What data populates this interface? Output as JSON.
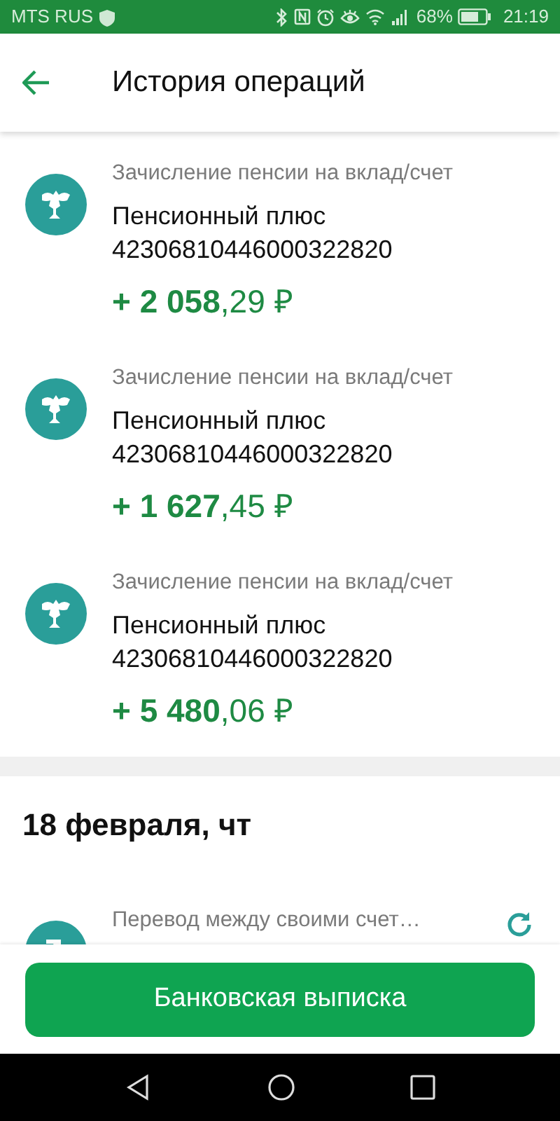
{
  "status_bar": {
    "carrier": "MTS RUS",
    "battery": "68%",
    "time": "21:19"
  },
  "header": {
    "title": "История операций"
  },
  "groups": [
    {
      "items": [
        {
          "kind": "pension",
          "category": "Зачисление пенсии на вклад/счет",
          "title": "Пенсионный плюс",
          "account": "42306810446000322820",
          "amount": "**+ 2 058**,29 ₽"
        },
        {
          "kind": "pension",
          "category": "Зачисление пенсии на вклад/счет",
          "title": "Пенсионный плюс",
          "account": "42306810446000322820",
          "amount": "**+ 1 627**,45 ₽"
        },
        {
          "kind": "pension",
          "category": "Зачисление пенсии на вклад/счет",
          "title": "Пенсионный плюс",
          "account": "42306810446000322820",
          "amount": "**+ 5 480**,06 ₽"
        }
      ]
    },
    {
      "date": "18 февраля, чт",
      "items": [
        {
          "kind": "transfer",
          "category": "Перевод между своими счет…",
          "repeat": true
        }
      ]
    }
  ],
  "footer_button": "Банковская выписка"
}
